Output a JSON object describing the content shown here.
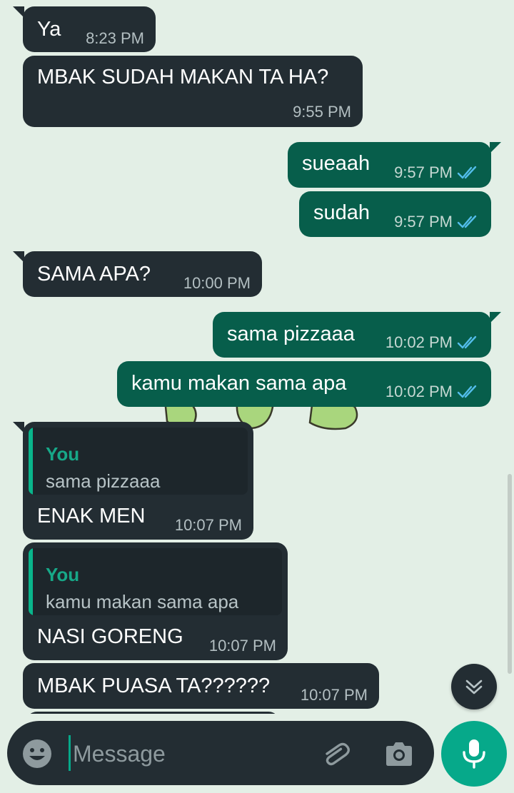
{
  "messages": [
    {
      "dir": "in",
      "text": "Ya",
      "time": "8:23 PM"
    },
    {
      "dir": "in",
      "text": "MBAK SUDAH MAKAN TA HA?",
      "time": "9:55 PM"
    },
    {
      "dir": "out",
      "text": "sueaah",
      "time": "9:57 PM",
      "status": "read"
    },
    {
      "dir": "out",
      "text": "sudah",
      "time": "9:57 PM",
      "status": "read"
    },
    {
      "dir": "in",
      "text": "SAMA APA?",
      "time": "10:00 PM"
    },
    {
      "dir": "out",
      "text": "sama pizzaaa",
      "time": "10:02 PM",
      "status": "read"
    },
    {
      "dir": "out",
      "text": "kamu makan sama apa",
      "time": "10:02 PM",
      "status": "read"
    },
    {
      "dir": "in",
      "text": "ENAK MEN",
      "time": "10:07 PM",
      "quote": {
        "author": "You",
        "text": "sama pizzaaa"
      }
    },
    {
      "dir": "in",
      "text": "NASI GORENG",
      "time": "10:07 PM",
      "quote": {
        "author": "You",
        "text": "kamu makan sama apa"
      }
    },
    {
      "dir": "in",
      "text": "MBAK PUASA TA??????",
      "time": "10:07 PM"
    }
  ],
  "composer": {
    "placeholder": "Message"
  },
  "icons": {
    "emoji": "emoji-icon",
    "attach": "paperclip-icon",
    "camera": "camera-icon",
    "mic": "microphone-icon",
    "scroll": "chevron-double-down-icon",
    "read_receipt": "double-check-icon"
  },
  "colors": {
    "background": "#e3efe6",
    "incoming_bubble": "#232d33",
    "outgoing_bubble": "#075e4b",
    "accent": "#06a98a",
    "read_tick": "#53bdeb",
    "quote_author": "#17a888"
  }
}
